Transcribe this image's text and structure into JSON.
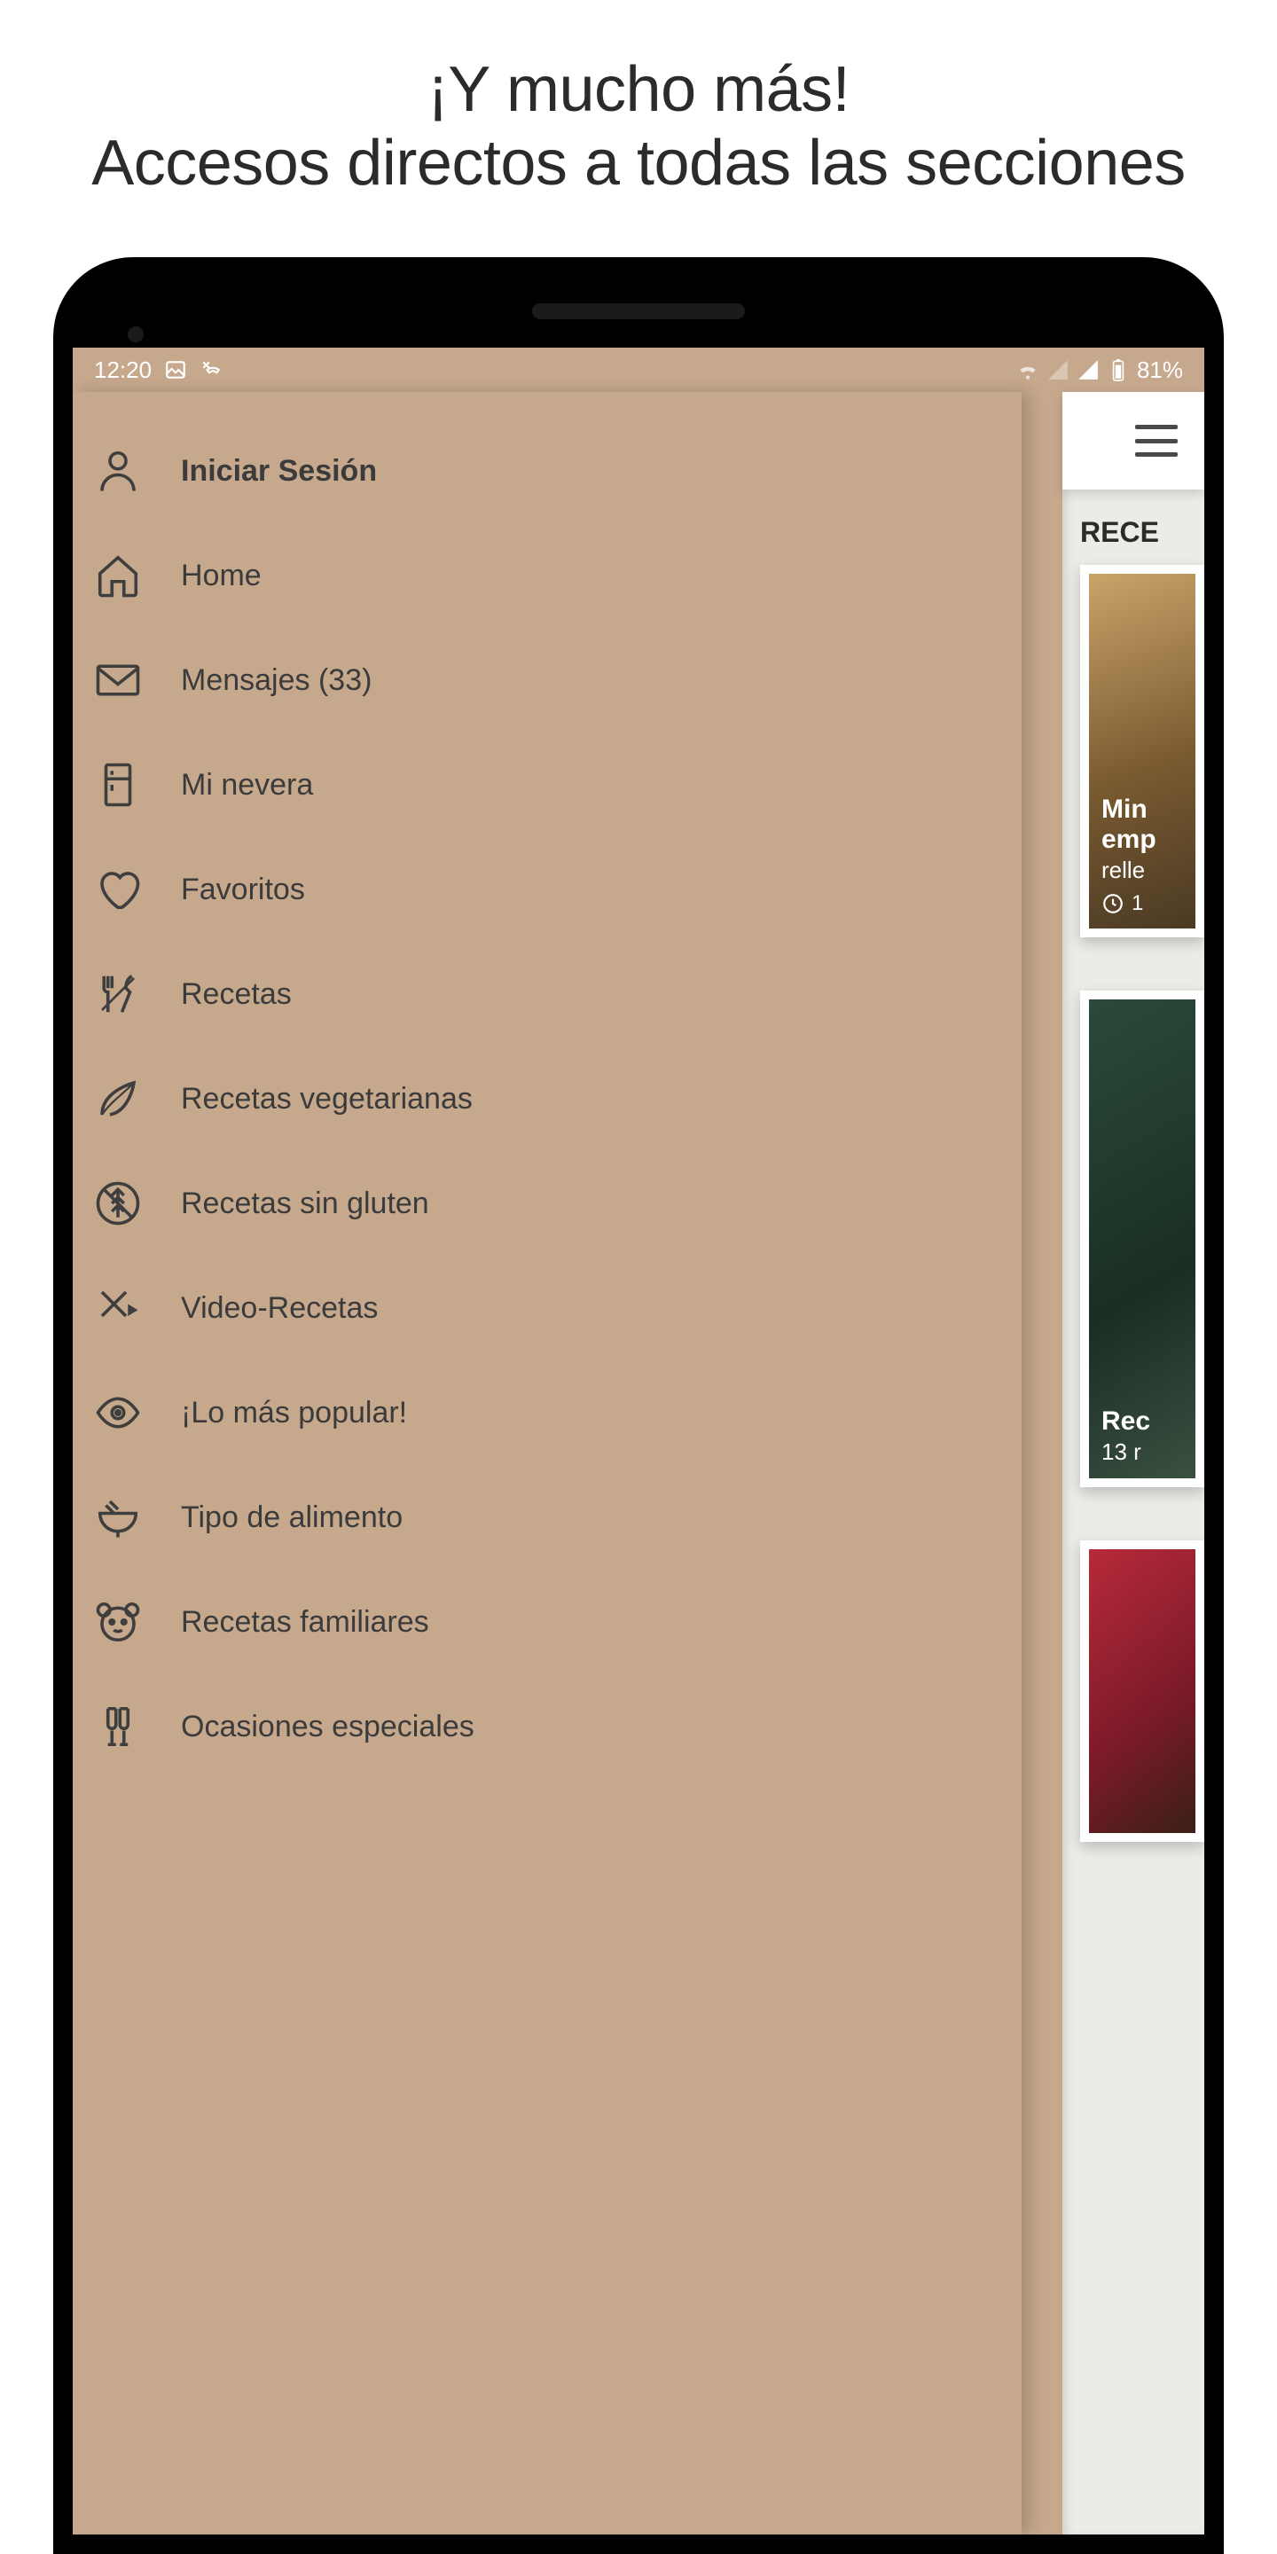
{
  "marketing": {
    "title": "¡Y mucho más!\nAccesos directos a todas las secciones"
  },
  "status_bar": {
    "time": "12:20",
    "battery_text": "81%"
  },
  "drawer": {
    "items": [
      {
        "label": "Iniciar Sesión",
        "icon": "user",
        "bold": true
      },
      {
        "label": "Home",
        "icon": "home",
        "bold": false
      },
      {
        "label": "Mensajes (33)",
        "icon": "envelope",
        "bold": false
      },
      {
        "label": "Mi nevera",
        "icon": "fridge",
        "bold": false
      },
      {
        "label": "Favoritos",
        "icon": "heart",
        "bold": false
      },
      {
        "label": "Recetas",
        "icon": "utensils",
        "bold": false
      },
      {
        "label": "Recetas vegetarianas",
        "icon": "leaf",
        "bold": false
      },
      {
        "label": "Recetas sin gluten",
        "icon": "gluten-free",
        "bold": false
      },
      {
        "label": "Video-Recetas",
        "icon": "video-utensils",
        "bold": false
      },
      {
        "label": "¡Lo más popular!",
        "icon": "eye",
        "bold": false
      },
      {
        "label": "Tipo de alimento",
        "icon": "bowl",
        "bold": false
      },
      {
        "label": "Recetas familiares",
        "icon": "bear",
        "bold": false
      },
      {
        "label": "Ocasiones especiales",
        "icon": "glasses",
        "bold": false
      }
    ]
  },
  "underlay": {
    "section_title": "RECE",
    "card1": {
      "title1": "Min",
      "title2": "emp",
      "subtitle": "relle",
      "meta": "1"
    },
    "card2": {
      "title1": "Rec",
      "subtitle": "13 r"
    }
  }
}
